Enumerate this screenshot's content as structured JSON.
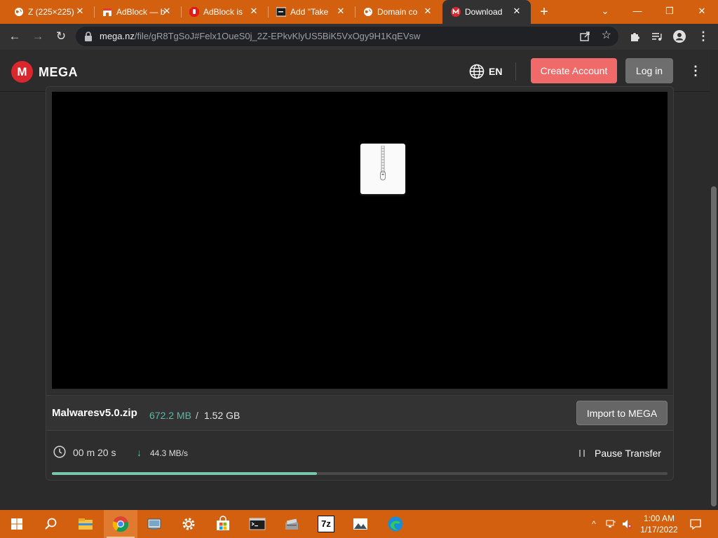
{
  "browser": {
    "tabs": [
      {
        "title": "Z (225×225)",
        "icon": "globe-icon",
        "active": false
      },
      {
        "title": "AdBlock — best",
        "icon": "adblock-store-icon",
        "active": false
      },
      {
        "title": "AdBlock is",
        "icon": "adblock-hand-icon",
        "active": false
      },
      {
        "title": "Add \"Take",
        "icon": "terminal-icon",
        "active": false
      },
      {
        "title": "Domain co",
        "icon": "globe-icon",
        "active": false
      },
      {
        "title": "Download",
        "icon": "mega-icon",
        "active": true
      }
    ],
    "new_tab": "+",
    "window_controls": {
      "dropdown": "⌄",
      "minimize": "—",
      "restore": "❐",
      "close": "✕"
    },
    "address": {
      "host": "mega.nz",
      "path": "/file/gR8TgSoJ#Felx1OueS0j_2Z-EPkvKlyUS5BiK5VxOgy9H1KqEVsw"
    },
    "nav": {
      "back": "←",
      "forward": "→",
      "reload": "↻"
    }
  },
  "mega": {
    "brand": "MEGA",
    "logo_letter": "M",
    "language": "EN",
    "create_account": "Create Account",
    "log_in": "Log in",
    "menu": "⋮"
  },
  "file": {
    "name": "Malwaresv5.0.zip",
    "downloaded": "672.2 MB",
    "separator": "/",
    "total": "1.52 GB",
    "import_label": "Import to MEGA",
    "eta": "00 m  20 s",
    "speed_arrow": "↓",
    "speed": "44.3 MB/s",
    "pause_label": "Pause Transfer",
    "progress": 0.43
  },
  "colors": {
    "accent_red": "#d9272e",
    "create_button": "#f16a6a",
    "progress": "#78c6ad",
    "chrome_frame": "#d2600f"
  },
  "taskbar": {
    "items": [
      "windows-start-icon",
      "search-icon",
      "file-explorer-icon",
      "chrome-icon",
      "control-panel-icon",
      "settings-icon",
      "microsoft-store-icon",
      "command-prompt-icon",
      "installer-icon",
      "7zip-icon",
      "photos-icon",
      "edge-icon"
    ],
    "sevenzip_label": "7z",
    "time": "1:00 AM",
    "date": "1/17/2022"
  }
}
